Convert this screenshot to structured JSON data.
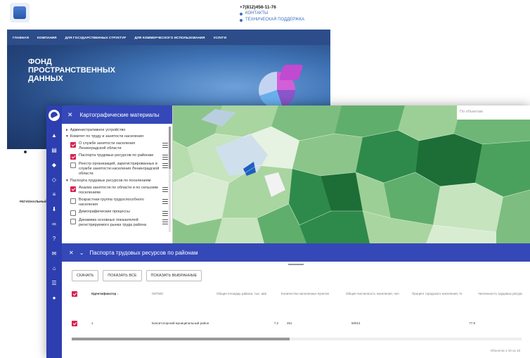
{
  "site": {
    "phone": "+7(812)456-11-76",
    "links": [
      "КОНТАКТЫ",
      "ТЕХНИЧЕСКАЯ ПОДДЕРЖКА"
    ],
    "nav": [
      "ГЛАВНАЯ",
      "КОМПАНИЯ",
      "ДЛЯ ГОСУДАРСТВЕННЫХ СТРУКТУР",
      "ДЛЯ КОММЕРЧЕСКОГО ИСПОЛЬЗОВАНИЯ",
      "УСЛУГИ"
    ],
    "hero_title": "ФОНД ПРОСТРАНСТВЕННЫХ ДАННЫХ",
    "region_text": "РЕГИОНАЛЬНЫЙ К"
  },
  "layers_panel": {
    "title": "Картографические материалы",
    "groups": [
      {
        "label": "Административное устройство",
        "items": []
      },
      {
        "label": "Комитет по труду и занятости населения",
        "items": [
          {
            "label": "О службе занятости населения Ленинградской области",
            "checked": true
          },
          {
            "label": "Паспорта трудовых ресурсов по районам",
            "checked": true
          },
          {
            "label": "Реестр организаций, зарегистрированных в службе занятости населения Ленинградской области",
            "checked": false
          }
        ]
      },
      {
        "label": "Паспорта трудовых ресурсов по поселениям",
        "items": [
          {
            "label": "Анализ занятости по области и по сельским поселениям",
            "checked": true
          },
          {
            "label": "Возрастная группа трудоспособного населения",
            "checked": false
          },
          {
            "label": "Демографические процессы",
            "checked": false
          },
          {
            "label": "Динамика основных показателей регистрируемого рынка труда района",
            "checked": false
          }
        ]
      }
    ]
  },
  "map": {
    "search_placeholder": "По объектам"
  },
  "table_panel": {
    "title": "Паспорта трудовых ресурсов по районам",
    "buttons": [
      "СКАЧАТЬ",
      "ПОКАЗАТЬ ВСЕ",
      "ПОКАЗАТЬ ВЫБРАННЫЕ"
    ],
    "columns": [
      "Идентификатор ↓",
      "ОКТМО",
      "Общая площадь района, тыс. км2",
      "Количество населенных пунктов",
      "Общая численность населения, чел",
      "Процент городского населения, %",
      "Численность трудовых ресурс"
    ],
    "rows": [
      {
        "id": "1",
        "name": "Бокситогорский муниципальный район",
        "area": "7.2",
        "settlements": "261",
        "population": "50014",
        "urban": "77.9"
      }
    ],
    "pager": "Объектов 1-10 из 18"
  },
  "sidebar_icons": [
    "mountain-icon",
    "map-icon",
    "layers-icon",
    "layers-off-icon",
    "list-icon",
    "download-icon",
    "link-icon",
    "help-icon",
    "mail-icon",
    "home-icon",
    "menu-icon",
    "account-icon"
  ],
  "colors": {
    "primary": "#3548b8",
    "sidebar": "#2d3fb0",
    "checkbox": "#d8234f",
    "site_nav": "#2c4d8a"
  }
}
